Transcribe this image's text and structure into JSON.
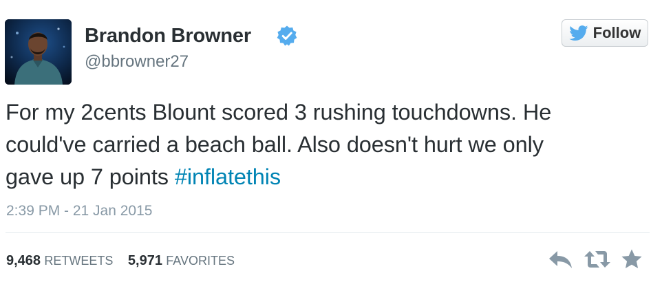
{
  "author": {
    "name": "Brandon Browner",
    "handle": "@bbrowner27",
    "verified": true
  },
  "follow_button": {
    "label": "Follow",
    "icon": "twitter-bird-icon"
  },
  "tweet": {
    "lines": [
      "For my 2cents Blount scored 3 rushing touchdowns. He",
      "could've carried a beach ball. Also doesn't hurt we only",
      "gave up 7 points "
    ],
    "hashtag": "#inflatethis",
    "timestamp": "2:39 PM - 21 Jan 2015"
  },
  "stats": {
    "retweets_count": "9,468",
    "retweets_label": "RETWEETS",
    "favorites_count": "5,971",
    "favorites_label": "FAVORITES"
  },
  "actions": [
    {
      "icon": "reply-icon"
    },
    {
      "icon": "retweet-icon"
    },
    {
      "icon": "favorite-star-icon"
    }
  ],
  "colors": {
    "text": "#292f33",
    "muted": "#66757f",
    "timestamp": "#8899a6",
    "link": "#0084b4",
    "verified_badge": "#55acee",
    "twitter_blue": "#55acee",
    "divider": "#e1e8ed"
  }
}
